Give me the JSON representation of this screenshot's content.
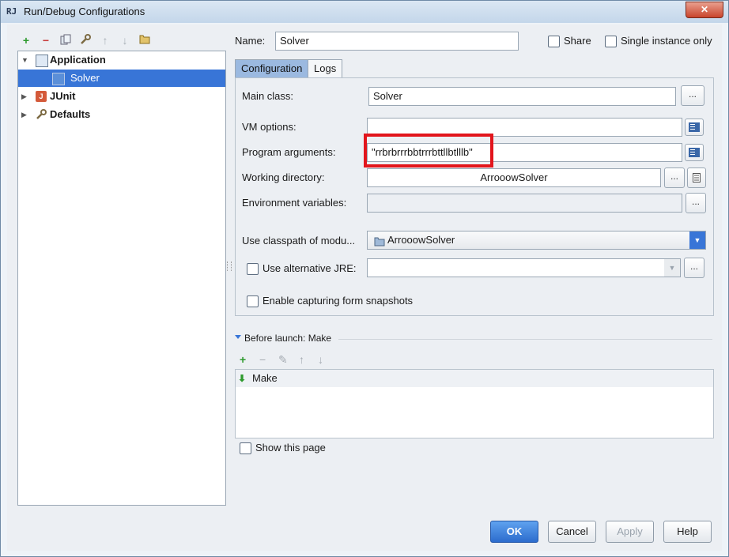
{
  "window": {
    "title": "Run/Debug Configurations",
    "icon_text": "RJ",
    "close_label": "✕"
  },
  "toolbar": {
    "add": "+",
    "remove": "−"
  },
  "tree": {
    "items": [
      {
        "label": "Application"
      },
      {
        "label": "Solver"
      },
      {
        "label": "JUnit"
      },
      {
        "label": "Defaults"
      }
    ]
  },
  "form": {
    "name_label": "Name:",
    "name_value": "Solver",
    "share_label": "Share",
    "single_instance_label": "Single instance only",
    "tabs": [
      "Configuration",
      "Logs"
    ],
    "main_class_label": "Main class:",
    "main_class_value": "Solver",
    "vm_options_label": "VM options:",
    "vm_options_value": "",
    "program_args_label": "Program arguments:",
    "program_args_value": "\"rrbrbrrrbbtrrrbttllbtlllb\"",
    "working_dir_label": "Working directory:",
    "working_dir_value": "ArrooowSolver",
    "env_vars_label": "Environment variables:",
    "env_vars_value": "",
    "classpath_label": "Use classpath of modu...",
    "classpath_value": "ArrooowSolver",
    "alt_jre_label": "Use alternative JRE:",
    "capture_label": "Enable capturing form snapshots",
    "dots": "..."
  },
  "before_launch": {
    "title": "Before launch: Make",
    "add": "+",
    "remove": "−",
    "items": [
      "Make"
    ],
    "show_page_label": "Show this page"
  },
  "buttons": {
    "ok": "OK",
    "cancel": "Cancel",
    "apply": "Apply",
    "help": "Help"
  },
  "colors": {
    "selection": "#3875d7",
    "highlight": "#e2151c",
    "primary_button": "#2c6ccd"
  }
}
